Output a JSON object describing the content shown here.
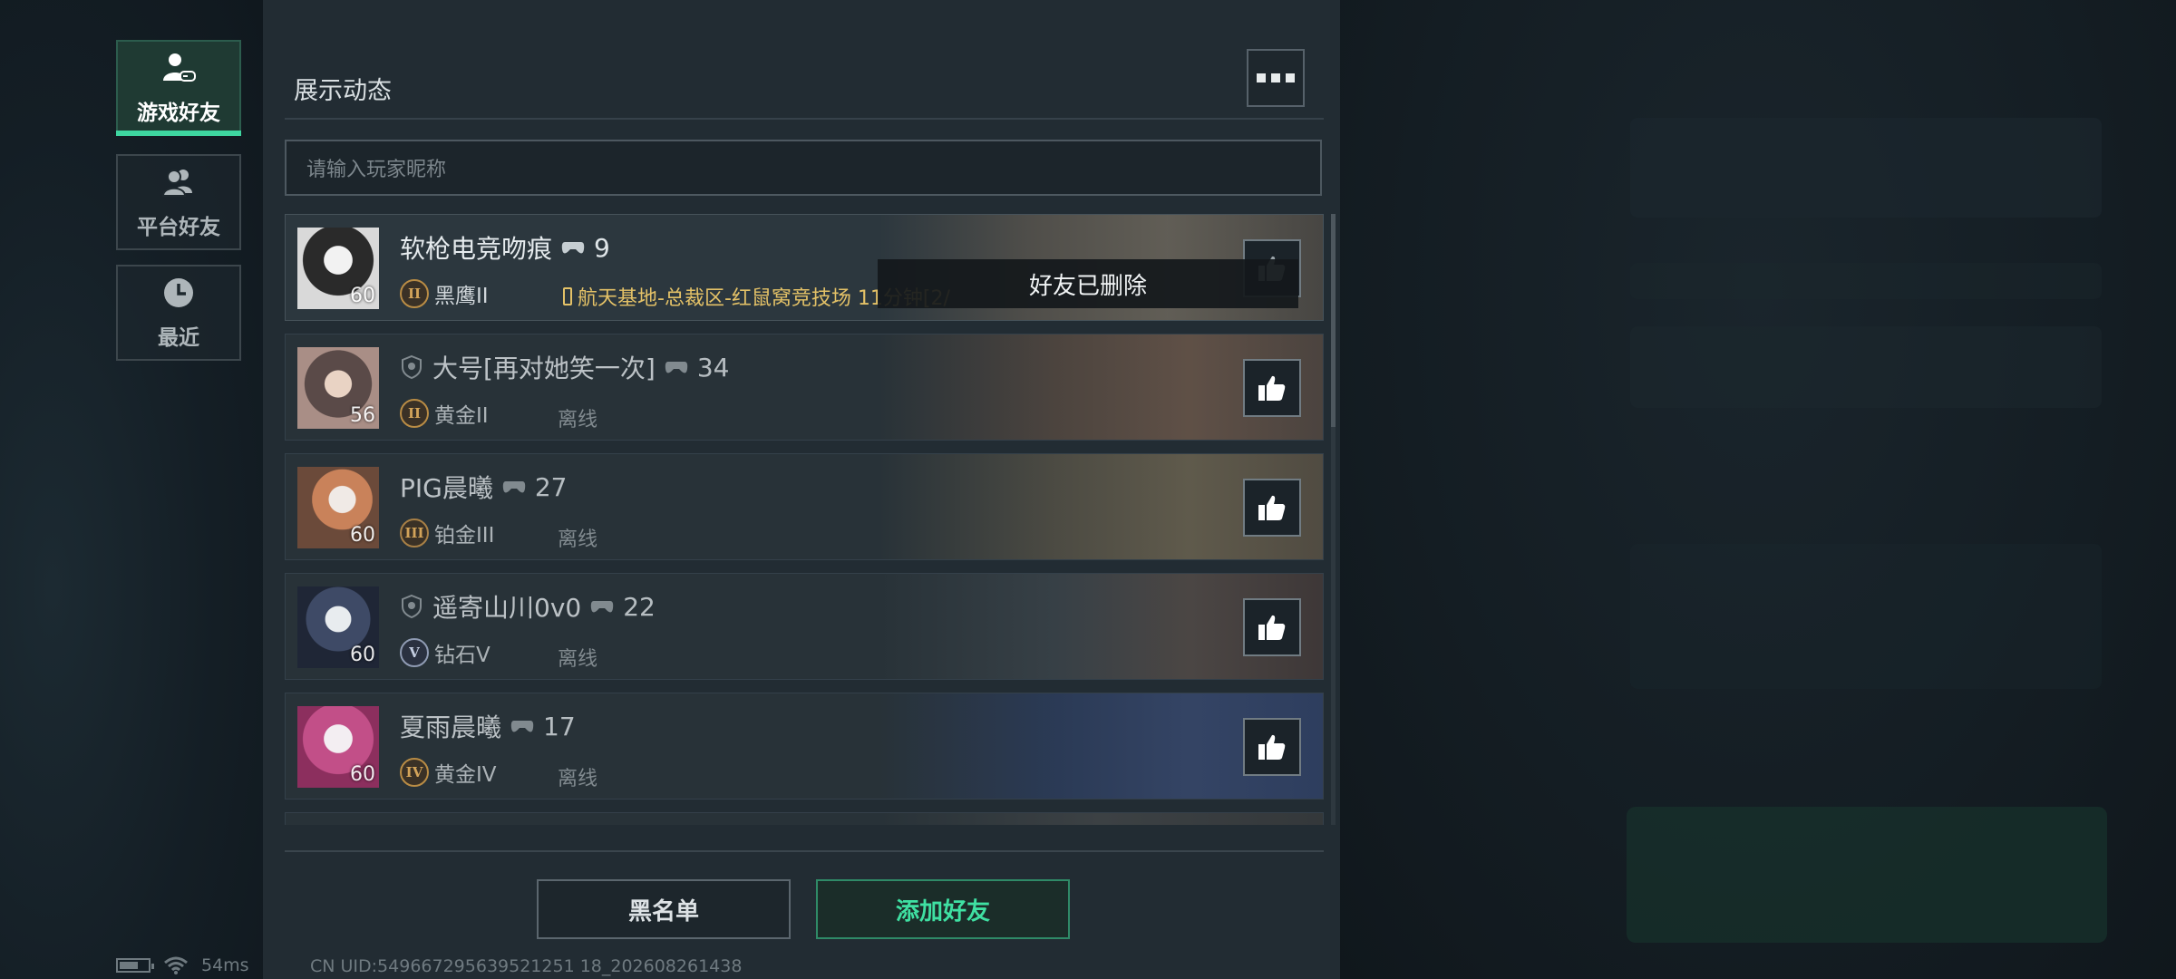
{
  "sidebar": {
    "tabs": [
      {
        "label": "游戏好友",
        "icon": "gamepad-friends-icon",
        "active": true
      },
      {
        "label": "平台好友",
        "icon": "friends-icon",
        "active": false
      },
      {
        "label": "最近",
        "icon": "clock-icon",
        "active": false
      }
    ]
  },
  "panel": {
    "title": "展示动态",
    "more_icon": "more-dots-icon",
    "search": {
      "placeholder": "请输入玩家昵称",
      "value": ""
    }
  },
  "friends": [
    {
      "name": "软枪电竞吻痕",
      "games": "9",
      "level": "60",
      "rank_badge": "II",
      "rank": "黑鹰II",
      "status": "",
      "location": "航天基地-总裁区-红鼠窝竞技场 11分钟[2/",
      "shield": false
    },
    {
      "name": "大号[再对她笑一次]",
      "games": "34",
      "level": "56",
      "rank_badge": "II",
      "rank": "黄金II",
      "status": "离线",
      "location": "",
      "shield": true
    },
    {
      "name": "PIG晨曦",
      "games": "27",
      "level": "60",
      "rank_badge": "III",
      "rank": "铂金III",
      "status": "离线",
      "location": "",
      "shield": false
    },
    {
      "name": "遥寄山川0v0",
      "games": "22",
      "level": "60",
      "rank_badge": "V",
      "rank": "钻石V",
      "status": "离线",
      "location": "",
      "shield": true
    },
    {
      "name": "夏雨晨曦",
      "games": "17",
      "level": "60",
      "rank_badge": "IV",
      "rank": "黄金IV",
      "status": "离线",
      "location": "",
      "shield": false
    }
  ],
  "toast": {
    "text": "好友已删除"
  },
  "buttons": {
    "blacklist": "黑名单",
    "add_friend": "添加好友"
  },
  "footer": {
    "uid": "CN UID:549667295639521251 18_202608261438",
    "ping": "54ms"
  },
  "colors": {
    "accent": "#3ed6a0",
    "location": "#e3c167",
    "panel": "#222c33"
  }
}
